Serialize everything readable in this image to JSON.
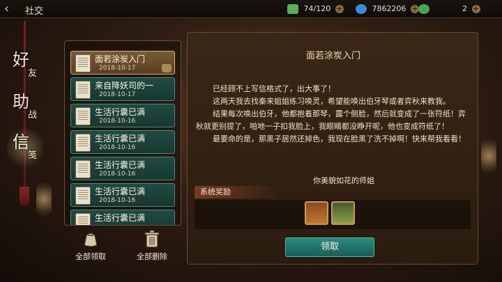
{
  "header": {
    "back_icon": "chevron-left-icon",
    "title": "社交",
    "resources": [
      {
        "icon": "tea-leaf-icon",
        "value": "74/120",
        "color": "#5ab05a"
      },
      {
        "icon": "gourd-icon",
        "value": "7862206",
        "color": "#3a8ad8"
      },
      {
        "icon": "jade-icon",
        "value": "2",
        "color": "#4aa84a"
      }
    ]
  },
  "sidebar": {
    "tabs": [
      {
        "big": "好",
        "small": "友"
      },
      {
        "big": "助",
        "small": "战"
      },
      {
        "big": "信",
        "small": "笺"
      }
    ]
  },
  "mail_list": [
    {
      "subject": "面若涂炭入门",
      "date": "2018-10-17",
      "selected": true
    },
    {
      "subject": "来自降妖司的一",
      "date": "2018-10-17",
      "selected": false
    },
    {
      "subject": "生活行囊已满",
      "date": "2018-10-16",
      "selected": false
    },
    {
      "subject": "生活行囊已满",
      "date": "2018-10-16",
      "selected": false
    },
    {
      "subject": "生活行囊已满",
      "date": "2018-10-16",
      "selected": false
    },
    {
      "subject": "生活行囊已满",
      "date": "2018-10-16",
      "selected": false
    },
    {
      "subject": "生活行囊已满",
      "date": "",
      "selected": false
    }
  ],
  "bottom_actions": {
    "claim_all": "全部领取",
    "delete_all": "全部删除"
  },
  "letter": {
    "title": "面若涂炭入门",
    "paragraphs": [
      "已经顾不上写信格式了，出大事了！",
      "这两天我去找秦来姐姐练习唤灵，希望能唤出伯牙琴或者弈秋来教我。",
      "结果每次唤出伯牙，他都抱着那琴，露个侧脸，然后就变成了一张符纸！弈秋就更别提了，啪地一子扣我脸上，我眼睛都没睁开呢，他也变成符纸了！",
      "最要命的是，那黑子居然还掉色，我现在脸黑了洗不掉啊！快来帮我看看！"
    ],
    "signature": "你美貌如花的师姐",
    "reward_title": "系统奖励",
    "rewards": [
      {
        "icon": "scroll-bundle-icon",
        "count": ""
      },
      {
        "icon": "dumplings-icon",
        "count": ""
      }
    ],
    "claim_button": "领取"
  }
}
